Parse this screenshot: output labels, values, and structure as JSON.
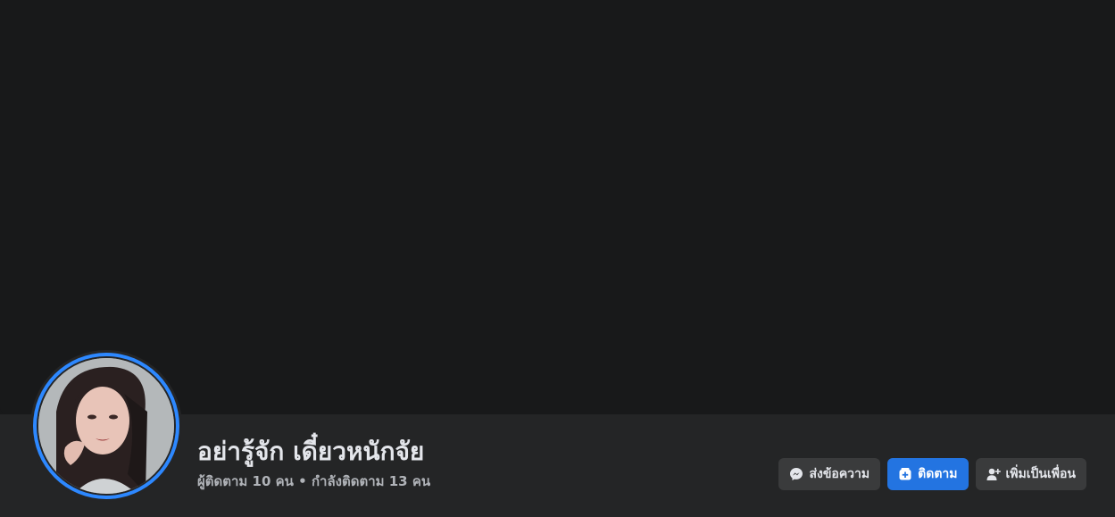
{
  "profile": {
    "name": "อย่ารู้จัก เดี๋ยวหนักจัย",
    "follow_stats": "ผู้ติดตาม 10 คน • กำลังติดตาม 13 คน",
    "avatar_icon": "profile-photo"
  },
  "actions": {
    "message_label": "ส่งข้อความ",
    "message_icon": "messenger-icon",
    "follow_label": "ติดตาม",
    "follow_icon": "follow-icon",
    "add_friend_label": "เพิ่มเป็นเพื่อน",
    "add_friend_icon": "add-friend-icon"
  },
  "colors": {
    "background": "#18191a",
    "bar": "#242526",
    "accent": "#2d88ff",
    "primary_button": "#2374e1",
    "secondary_button": "#3a3b3c",
    "text_primary": "#e4e6eb",
    "text_secondary": "#b0b3b8"
  }
}
